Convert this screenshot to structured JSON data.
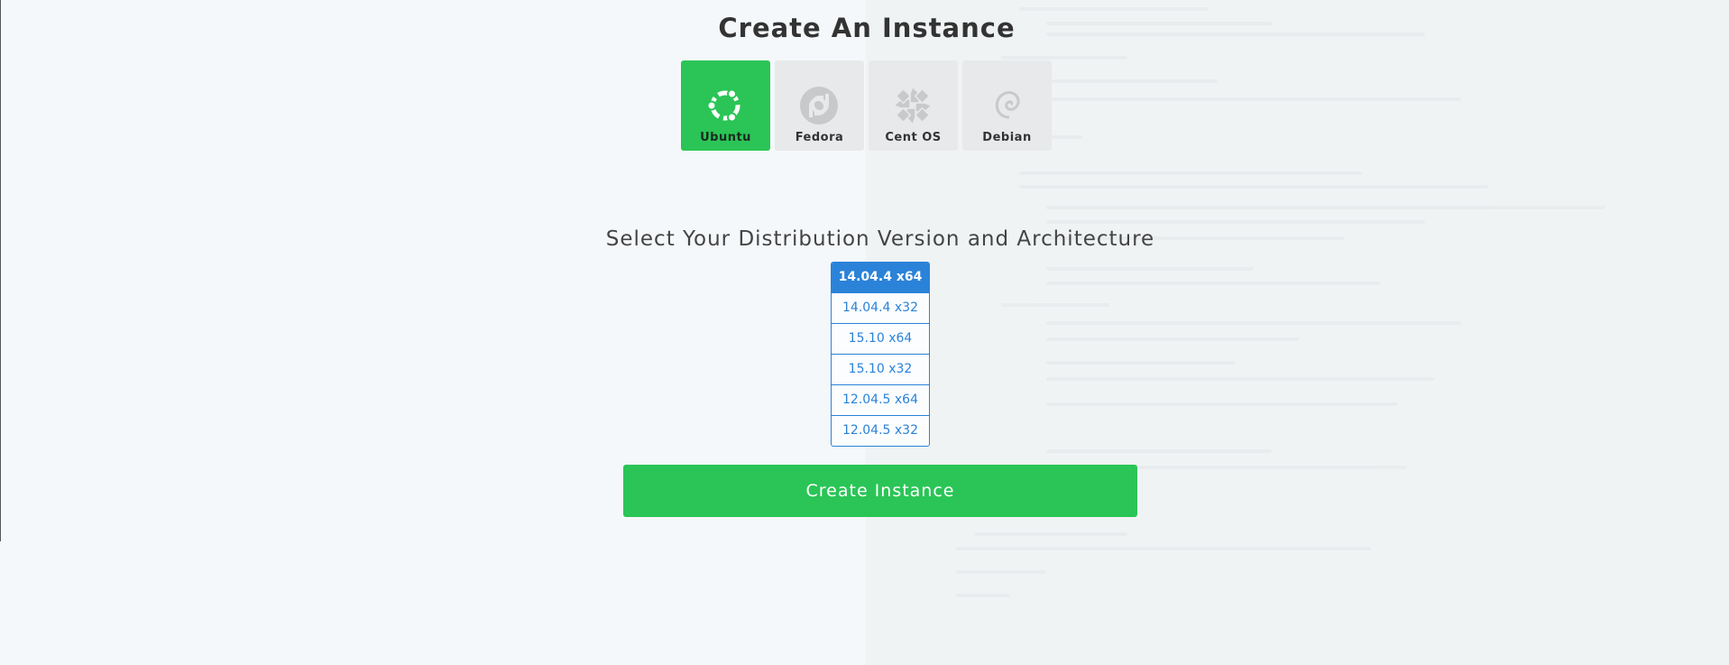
{
  "page": {
    "title": "Create An Instance"
  },
  "distributions": [
    {
      "label": "Ubuntu",
      "icon": "ubuntu-logo-icon",
      "selected": true
    },
    {
      "label": "Fedora",
      "icon": "fedora-logo-icon",
      "selected": false
    },
    {
      "label": "Cent OS",
      "icon": "centos-logo-icon",
      "selected": false
    },
    {
      "label": "Debian",
      "icon": "debian-logo-icon",
      "selected": false
    }
  ],
  "versions_section": {
    "title": "Select Your Distribution Version and Architecture",
    "options": [
      {
        "label": "14.04.4 x64",
        "selected": true
      },
      {
        "label": "14.04.4 x32",
        "selected": false
      },
      {
        "label": "15.10 x64",
        "selected": false
      },
      {
        "label": "15.10 x32",
        "selected": false
      },
      {
        "label": "12.04.5 x64",
        "selected": false
      },
      {
        "label": "12.04.5 x32",
        "selected": false
      }
    ]
  },
  "actions": {
    "create_label": "Create Instance"
  },
  "colors": {
    "accent_green": "#2ac556",
    "accent_blue": "#2b82d9",
    "card_gray": "#e8e9ea"
  }
}
